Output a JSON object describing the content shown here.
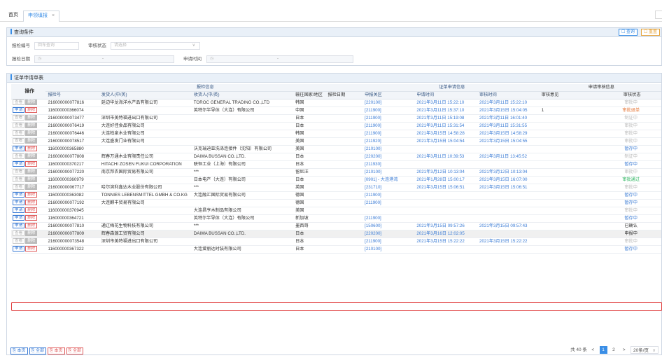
{
  "tabs": {
    "home": "首页",
    "active": "申领填报",
    "close": "×"
  },
  "query": {
    "title": "查询条件",
    "query_button": "查询",
    "reset_button": "重置",
    "report_no_label": "报检编号",
    "report_no_placeholder": "回车查询",
    "status_label": "审核状态",
    "status_placeholder": "请选择",
    "report_date_label": "报检日期",
    "apply_time_label": "申请时间",
    "range_sep": "-"
  },
  "list": {
    "title": "证单申请单表",
    "header": {
      "op": "操作",
      "g_report": "报检信息",
      "g_apply": "证单申请信息",
      "g_review": "申请审核信息",
      "report_no": "报检号",
      "shipper": "发货人(中/英)",
      "consignee": "收货人(中/英)",
      "dest": "输往国家/地区",
      "report_date": "报检日期",
      "port": "申报关区",
      "apply_time": "申请时间",
      "review_time": "审核时间",
      "opinion": "审核意见",
      "status": "审核状态"
    },
    "btn_view": "查看",
    "btn_apply": "申请",
    "btn_delete": "删除",
    "rows": [
      {
        "mode": "view",
        "report_no": "216000000077816",
        "shipper": "延边华龙海洋水产品有限公司",
        "consignee": "TOROC GENERAL TRADING CO.,LTD",
        "dest": "韩国",
        "report_date": "",
        "port": "[220100]",
        "apply_time": "2021年3月11日 15:22:10",
        "review_time": "2021年3月11日 15:22:10",
        "opinion": "",
        "status": "审批中",
        "status_class": "st-gray"
      },
      {
        "mode": "apply",
        "report_no": "116000000366074",
        "shipper": "",
        "consignee": "英特尔半导体（大连）有限公司",
        "dest": "中国",
        "report_date": "",
        "port": "[211900]",
        "apply_time": "2021年3月11日 15:37:10",
        "review_time": "2021年3月15日 15:04:05",
        "opinion": "1",
        "status": "审批退单",
        "status_class": "st-orange"
      },
      {
        "mode": "view",
        "report_no": "216000000073477",
        "shipper": "深圳市美特福进出口有限公司",
        "consignee": "",
        "dest": "日本",
        "report_date": "",
        "port": "[211900]",
        "apply_time": "2021年3月11日 15:19:08",
        "review_time": "2021年3月11日 16:01:40",
        "opinion": "",
        "status": "制证中",
        "status_class": "st-gray"
      },
      {
        "mode": "view",
        "report_no": "216000000076419",
        "shipper": "大连好佳食品有限公司",
        "consignee": "",
        "dest": "日本",
        "report_date": "",
        "port": "[211900]",
        "apply_time": "2021年3月11日 15:31:54",
        "review_time": "2021年3月11日 15:31:55",
        "opinion": "",
        "status": "审批中",
        "status_class": "st-gray"
      },
      {
        "mode": "view",
        "report_no": "216000000076446",
        "shipper": "大连柏泉木业有限公司",
        "consignee": "",
        "dest": "韩国",
        "report_date": "",
        "port": "[211900]",
        "apply_time": "2021年3月15日 14:58:28",
        "review_time": "2021年3月15日 14:58:29",
        "opinion": "",
        "status": "审批中",
        "status_class": "st-gray"
      },
      {
        "mode": "view",
        "report_no": "216000000078517",
        "shipper": "大连盛发门业有限公司",
        "consignee": "",
        "dest": "美国",
        "report_date": "",
        "port": "[211920]",
        "apply_time": "2021年3月15日 15:04:54",
        "review_time": "2021年3月15日 15:04:55",
        "opinion": "",
        "status": "审批中",
        "status_class": "st-gray"
      },
      {
        "mode": "apply",
        "report_no": "116000000365880",
        "shipper": "",
        "consignee": "沃克瑞迪亚洗涤连接件（沈阳）有限公司",
        "dest": "美国",
        "report_date": "",
        "port": "[210100]",
        "apply_time": "",
        "review_time": "",
        "opinion": "",
        "status": "暂存中",
        "status_class": "st-blue"
      },
      {
        "mode": "view",
        "report_no": "216000000077808",
        "shipper": "辉春万通木业有限责任公司",
        "consignee": "DAIWA BUSSAN CO.,LTD.",
        "dest": "日本",
        "report_date": "",
        "port": "[220200]",
        "apply_time": "2021年3月11日 10:39:53",
        "review_time": "2021年3月11日 13:45:52",
        "opinion": "",
        "status": "制证中",
        "status_class": "st-gray"
      },
      {
        "mode": "apply",
        "report_no": "116000000370217",
        "shipper": "HITACHI ZOSEN FUKUI CORPORATION",
        "consignee": "联恒工业（上海）有限公司",
        "dest": "日本",
        "report_date": "",
        "port": "[211930]",
        "apply_time": "",
        "review_time": "",
        "opinion": "",
        "status": "暂存中",
        "status_class": "st-blue"
      },
      {
        "mode": "view",
        "report_no": "216000000077220",
        "shipper": "南京邦农国际贸易有限公司",
        "consignee": "***",
        "dest": "留尼汪",
        "report_date": "",
        "port": "[210100]",
        "apply_time": "2021年3月12日 10:13:04",
        "review_time": "2021年3月12日 10:13:04",
        "opinion": "",
        "status": "审批中",
        "status_class": "st-gray"
      },
      {
        "mode": "view",
        "report_no": "116000000360979",
        "shipper": "",
        "consignee": "日本电产（大连）有限公司",
        "dest": "日本",
        "report_date": "",
        "port": "[0901] - 大连港湾",
        "apply_time": "2021年1月28日 15:00:17",
        "review_time": "2021年3月15日 16:07:00",
        "opinion": "",
        "status": "审批通过",
        "status_class": "st-green"
      },
      {
        "mode": "view",
        "report_no": "216000000067717",
        "shipper": "哈尔滨利鑫达木业股份有限公司",
        "consignee": "***",
        "dest": "英国",
        "report_date": "",
        "port": "[231710]",
        "apply_time": "2021年3月15日 15:06:51",
        "review_time": "2021年3月15日 15:06:51",
        "opinion": "",
        "status": "审批中",
        "status_class": "st-gray"
      },
      {
        "mode": "apply",
        "report_no": "116000000363082",
        "shipper": "TONNIES LEBENSMITTEL GMBH & CO.KG",
        "consignee": "大连融汇国际贸易有限公司",
        "dest": "德国",
        "report_date": "",
        "port": "[211900]",
        "apply_time": "",
        "review_time": "",
        "opinion": "",
        "status": "暂存中",
        "status_class": "st-blue"
      },
      {
        "mode": "apply",
        "report_no": "216000000077192",
        "shipper": "大连麒丰贸易有限公司",
        "consignee": "",
        "dest": "德国",
        "report_date": "",
        "port": "[211900]",
        "apply_time": "",
        "review_time": "",
        "opinion": "",
        "status": "暂存中",
        "status_class": "st-blue"
      },
      {
        "mode": "apply",
        "report_no": "116000000370945",
        "shipper": "",
        "consignee": "大连昌亨木制品有限公司",
        "dest": "美国",
        "report_date": "",
        "port": "",
        "apply_time": "",
        "review_time": "",
        "opinion": "",
        "status": "审批中",
        "status_class": "st-gray"
      },
      {
        "mode": "apply",
        "report_no": "116000000364721",
        "shipper": "",
        "consignee": "英特尔半导体（大连）有限公司",
        "dest": "新加坡",
        "report_date": "",
        "port": "[211900]",
        "apply_time": "",
        "review_time": "",
        "opinion": "",
        "status": "暂存中",
        "status_class": "st-blue"
      },
      {
        "mode": "apply",
        "report_no": "216000000077810",
        "shipper": "通辽梅花生物科技有限公司",
        "consignee": "***",
        "dest": "墨西哥",
        "report_date": "",
        "port": "[150600]",
        "apply_time": "2021年3月15日 09:57:26",
        "review_time": "2021年3月15日 09:57:43",
        "opinion": "",
        "status": "已确认",
        "status_class": "st-dark"
      },
      {
        "mode": "view",
        "report_no": "216000000077809",
        "shipper": "辉春森源工贸有限公司",
        "consignee": "DAIWA BUSSAN CO.,LTD.",
        "dest": "日本",
        "report_date": "",
        "port": "[220200]",
        "apply_time": "2021年3月16日 12:02:05",
        "review_time": "",
        "opinion": "",
        "status": "申报中",
        "status_class": "st-dark",
        "highlight": true
      },
      {
        "mode": "view",
        "report_no": "216000000073548",
        "shipper": "深圳市美特福进出口有限公司",
        "consignee": "",
        "dest": "日本",
        "report_date": "",
        "port": "[211900]",
        "apply_time": "2021年3月15日 15:22:22",
        "review_time": "2021年3月15日 15:22:22",
        "opinion": "",
        "status": "审批中",
        "status_class": "st-gray"
      },
      {
        "mode": "apply",
        "report_no": "116000000367322",
        "shipper": "",
        "consignee": "大连爱丽达时装有限公司",
        "dest": "日本",
        "report_date": "",
        "port": "[210100]",
        "apply_time": "",
        "review_time": "",
        "opinion": "",
        "status": "暂存中",
        "status_class": "st-blue"
      }
    ]
  },
  "footer": {
    "btn_export_page": "本页",
    "btn_export_all": "全部",
    "btn_print_page": "本页",
    "btn_print_all": "全部",
    "total": "共 40 条",
    "prev": "<",
    "page1": "1",
    "page2": "2",
    "next": ">",
    "page_size": "20条/页",
    "size_arrow": "∨"
  },
  "colors": {
    "accent": "#3a8ee6",
    "danger": "#e05b5b",
    "highlight_border": "#e03c3c"
  }
}
